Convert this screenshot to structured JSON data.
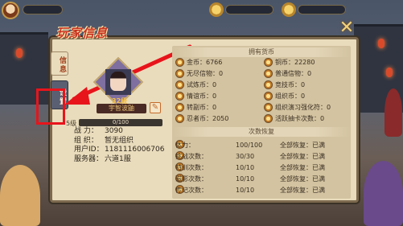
{
  "panel_title": "玩家信息",
  "tabs": {
    "info": "信息",
    "settings": "设置"
  },
  "player": {
    "level": "32级",
    "name": "宇智波鼬",
    "exp_label": "5级",
    "exp_text": "0/100",
    "stats": [
      {
        "key": "战 力：",
        "value": "3090"
      },
      {
        "key": "组 织：",
        "value": "暂无组织"
      },
      {
        "key": "用户ID：",
        "value": "1181116006706"
      },
      {
        "key": "服务器：",
        "value": "六道1服"
      }
    ]
  },
  "currency_section": {
    "title": "拥有货币",
    "items": [
      {
        "label": "金币：",
        "value": "6766"
      },
      {
        "label": "铜币：",
        "value": "22280"
      },
      {
        "label": "无尽信物：",
        "value": "0"
      },
      {
        "label": "普通信物：",
        "value": "0"
      },
      {
        "label": "试炼币：",
        "value": "0"
      },
      {
        "label": "竞技币：",
        "value": "0"
      },
      {
        "label": "情谊币：",
        "value": "0"
      },
      {
        "label": "组织币：",
        "value": "0"
      },
      {
        "label": "转副币：",
        "value": "0"
      },
      {
        "label": "组织演习强化符：",
        "value": "0"
      },
      {
        "label": "忍者币：",
        "value": "2050"
      },
      {
        "label": "活跃抽卡次数：",
        "value": "0"
      }
    ]
  },
  "recovery_section": {
    "title": "次数恢复",
    "rows": [
      {
        "name": "体力：",
        "count": "100/100",
        "status": "全部恢复：已满"
      },
      {
        "name": "挑战次数：",
        "count": "30/30",
        "status": "全部恢复：已满"
      },
      {
        "name": "特训次数：",
        "count": "10/10",
        "status": "全部恢复：已满"
      },
      {
        "name": "磁影次数：",
        "count": "10/10",
        "status": "全部恢复：已满"
      },
      {
        "name": "传记次数：",
        "count": "10/10",
        "status": "全部恢复：已满"
      }
    ]
  },
  "colors": {
    "highlight": "#e8141b",
    "panel": "#e9dcbc",
    "title": "#c8321f"
  }
}
